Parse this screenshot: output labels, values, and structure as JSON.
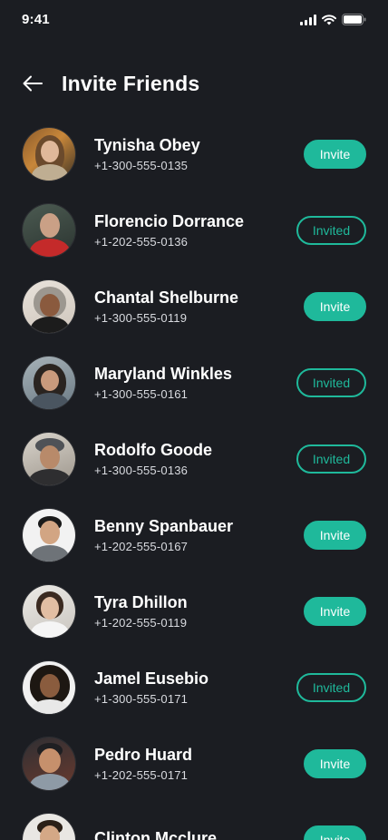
{
  "status_bar": {
    "time": "9:41"
  },
  "header": {
    "title": "Invite Friends"
  },
  "colors": {
    "background": "#1b1d22",
    "accent": "#1fb99b",
    "text": "#ffffff"
  },
  "contacts": [
    {
      "name": "Tynisha Obey",
      "phone": "+1-300-555-0135",
      "button": "Invite",
      "state": "invite"
    },
    {
      "name": "Florencio Dorrance",
      "phone": "+1-202-555-0136",
      "button": "Invited",
      "state": "invited"
    },
    {
      "name": "Chantal Shelburne",
      "phone": "+1-300-555-0119",
      "button": "Invite",
      "state": "invite"
    },
    {
      "name": "Maryland Winkles",
      "phone": "+1-300-555-0161",
      "button": "Invited",
      "state": "invited"
    },
    {
      "name": "Rodolfo Goode",
      "phone": "+1-300-555-0136",
      "button": "Invited",
      "state": "invited"
    },
    {
      "name": "Benny Spanbauer",
      "phone": "+1-202-555-0167",
      "button": "Invite",
      "state": "invite"
    },
    {
      "name": "Tyra Dhillon",
      "phone": "+1-202-555-0119",
      "button": "Invite",
      "state": "invite"
    },
    {
      "name": "Jamel Eusebio",
      "phone": "+1-300-555-0171",
      "button": "Invited",
      "state": "invited"
    },
    {
      "name": "Pedro Huard",
      "phone": "+1-202-555-0171",
      "button": "Invite",
      "state": "invite"
    },
    {
      "name": "Clinton Mcclure",
      "phone": "",
      "button": "Invite",
      "state": "invite"
    }
  ]
}
